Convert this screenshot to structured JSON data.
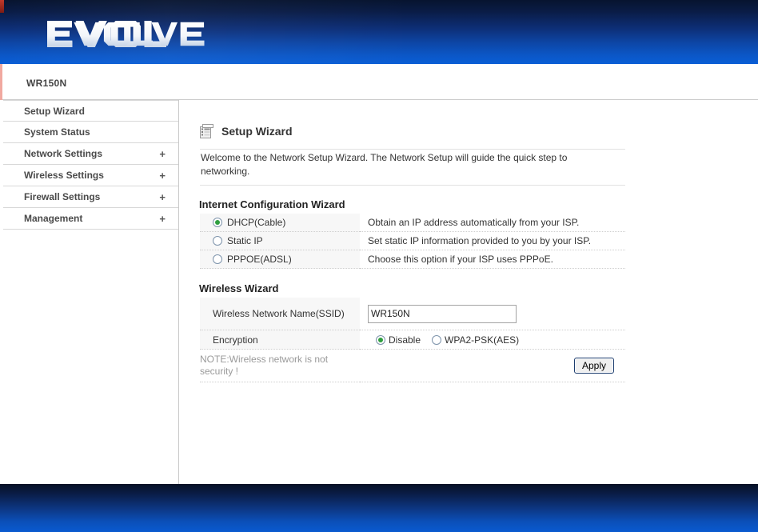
{
  "brand": {
    "logo_text": "EVOLVE",
    "logo_icon": "evolve-wordmark"
  },
  "header": {
    "model": "WR150N"
  },
  "sidebar": {
    "items": [
      {
        "label": "Setup Wizard",
        "expandable": false,
        "expand_icon": ""
      },
      {
        "label": "System Status",
        "expandable": false,
        "expand_icon": ""
      },
      {
        "label": "Network Settings",
        "expandable": true,
        "expand_icon": "+"
      },
      {
        "label": "Wireless Settings",
        "expandable": true,
        "expand_icon": "+"
      },
      {
        "label": "Firewall Settings",
        "expandable": true,
        "expand_icon": "+"
      },
      {
        "label": "Management",
        "expandable": true,
        "expand_icon": "+"
      }
    ]
  },
  "page": {
    "heading": "Setup Wizard",
    "heading_icon": "list-document-icon",
    "welcome": "Welcome to the Network Setup Wizard. The Network Setup will guide the quick step to networking."
  },
  "internet_wizard": {
    "title": "Internet Configuration Wizard",
    "options": [
      {
        "label": "DHCP(Cable)",
        "description": "Obtain an IP address automatically from your ISP.",
        "selected": true
      },
      {
        "label": "Static IP",
        "description": "Set static IP information provided to you by your ISP.",
        "selected": false
      },
      {
        "label": "PPPOE(ADSL)",
        "description": "Choose this option if your ISP uses PPPoE.",
        "selected": false
      }
    ]
  },
  "wireless_wizard": {
    "title": "Wireless Wizard",
    "ssid_label": "Wireless Network Name(SSID)",
    "ssid_value": "WR150N",
    "ssid_placeholder": "",
    "encryption_label": "Encryption",
    "encryption_options": [
      {
        "label": "Disable",
        "selected": true
      },
      {
        "label": "WPA2-PSK(AES)",
        "selected": false
      }
    ],
    "note": "NOTE:Wireless network is not security !",
    "apply_label": "Apply"
  },
  "colors": {
    "banner_top": "#07142f",
    "banner_bottom": "#0a5ed6",
    "accent_red": "#f1a9a0",
    "radio_green": "#2f9e3f",
    "note_gray": "#9a9a9a"
  }
}
